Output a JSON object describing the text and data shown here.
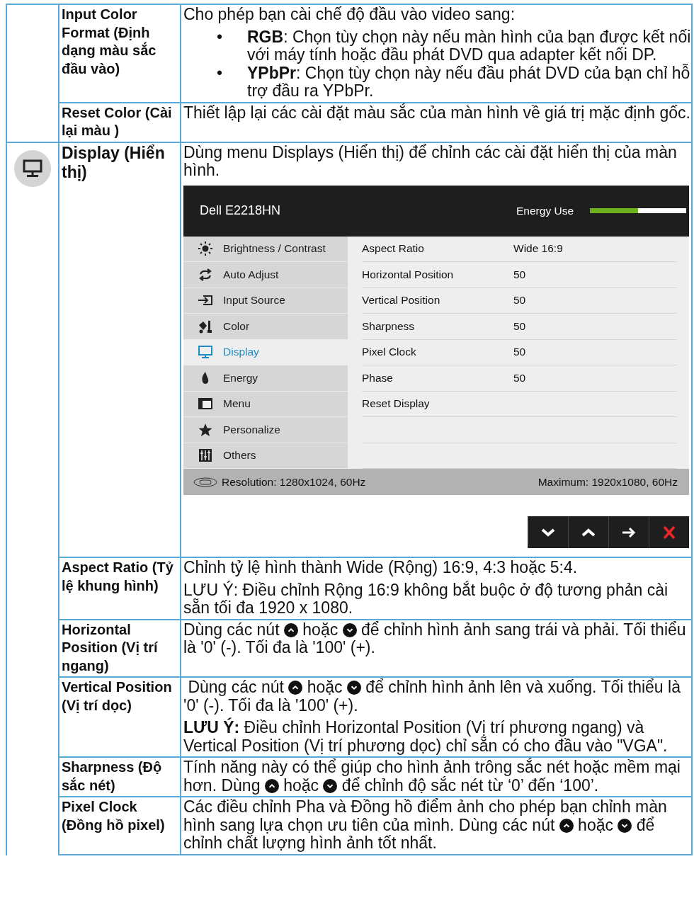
{
  "groups": [
    {
      "kind": "continued",
      "rows": [
        {
          "name": "Input Color Format (Định dạng màu sắc đầu vào)",
          "blocks": [
            {
              "kind": "paragraph",
              "parts": [
                {
                  "kind": "text",
                  "text": "Cho phép bạn cài chế độ đầu vào video sang:"
                }
              ]
            },
            {
              "kind": "bullets",
              "items": [
                {
                  "mark": "•",
                  "text": "**RGB**: Chọn tùy chọn này nếu màn hình của bạn được kết nối với máy tính hoặc đầu phát DVD qua adapter kết nối DP."
                },
                {
                  "mark": "•",
                  "text": "**YPbPr**: Chọn tùy chọn này nếu đầu phát DVD của bạn chỉ hỗ trợ đầu ra YPbPr."
                }
              ]
            }
          ]
        },
        {
          "name": "Reset Color (Cài lại màu )",
          "blocks": [
            {
              "kind": "paragraph",
              "parts": [
                {
                  "kind": "text",
                  "text": "Thiết lập lại các cài đặt màu sắc của màn hình về giá trị mặc định gốc."
                }
              ]
            }
          ]
        }
      ]
    },
    {
      "kind": "display",
      "rows": [
        {
          "name": "Display (Hiển thị)",
          "large": true,
          "blocks": [
            {
              "kind": "paragraph",
              "parts": [
                {
                  "kind": "text",
                  "text": "Dùng menu Displays (Hiển thị) để chỉnh các cài đặt hiển thị của màn hình."
                }
              ]
            },
            {
              "kind": "osd",
              "osd": {
                "title": "Dell E2218HN",
                "energy": {
                  "label": "Energy Use",
                  "level": 0.5
                },
                "menu": [
                  {
                    "kind": "brightness",
                    "label": "Brightness / Contrast",
                    "selected": false
                  },
                  {
                    "kind": "auto",
                    "label": "Auto Adjust",
                    "selected": false
                  },
                  {
                    "kind": "input",
                    "label": "Input Source",
                    "selected": false
                  },
                  {
                    "kind": "color",
                    "label": "Color",
                    "selected": false
                  },
                  {
                    "kind": "display",
                    "label": "Display",
                    "selected": true
                  },
                  {
                    "kind": "energy",
                    "label": "Energy",
                    "selected": false
                  },
                  {
                    "kind": "menu",
                    "label": "Menu",
                    "selected": false
                  },
                  {
                    "kind": "personalize",
                    "label": "Personalize",
                    "selected": false
                  },
                  {
                    "kind": "others",
                    "label": "Others",
                    "selected": false
                  }
                ],
                "settings": [
                  {
                    "label": "Aspect Ratio",
                    "value": "Wide 16:9"
                  },
                  {
                    "label": "Horizontal Position",
                    "value": "50"
                  },
                  {
                    "label": "Vertical Position",
                    "value": "50"
                  },
                  {
                    "label": "Sharpness",
                    "value": "50"
                  },
                  {
                    "label": "Pixel Clock",
                    "value": "50"
                  },
                  {
                    "label": "Phase",
                    "value": "50"
                  },
                  {
                    "label": "Reset Display"
                  }
                ],
                "resolution": "Resolution: 1280x1024, 60Hz",
                "maximum": "Maximum: 1920x1080, 60Hz",
                "buttons": [
                  {
                    "kind": "down"
                  },
                  {
                    "kind": "up"
                  },
                  {
                    "kind": "right"
                  },
                  {
                    "kind": "close"
                  }
                ]
              }
            }
          ]
        },
        {
          "name": "Aspect Ratio (Tỷ lệ khung hình)",
          "blocks": [
            {
              "kind": "paragraph",
              "parts": [
                {
                  "kind": "text",
                  "text": "Chỉnh tỷ lệ hình thành Wide (Rộng) 16:9, 4:3 hoặc 5:4."
                }
              ]
            },
            {
              "kind": "paragraph",
              "parts": [
                {
                  "kind": "text",
                  "text": "LƯU Ý: Điều chỉnh Rộng 16:9 không bắt buộc ở độ tương phản cài sẵn tối đa 1920 x 1080."
                }
              ]
            }
          ]
        },
        {
          "name": "Horizontal Position (Vị trí ngang)",
          "blocks": [
            {
              "kind": "paragraph",
              "parts": [
                {
                  "kind": "text",
                  "text": "Dùng các nút "
                },
                {
                  "kind": "up"
                },
                {
                  "kind": "text",
                  "text": " hoặc "
                },
                {
                  "kind": "down"
                },
                {
                  "kind": "text",
                  "text": " để chỉnh hình ảnh sang trái và phải. Tối thiểu là '0' (-). Tối đa là '100' (+)."
                }
              ]
            }
          ]
        },
        {
          "name": "Vertical Position (Vị trí dọc)",
          "blocks": [
            {
              "kind": "paragraph",
              "parts": [
                {
                  "kind": "text",
                  "text": " Dùng các nút "
                },
                {
                  "kind": "up"
                },
                {
                  "kind": "text",
                  "text": " hoặc "
                },
                {
                  "kind": "down"
                },
                {
                  "kind": "text",
                  "text": " để chỉnh hình ảnh lên và xuống. Tối thiểu là '0' (-). Tối đa là '100' (+)."
                }
              ]
            },
            {
              "kind": "paragraph",
              "parts": [
                {
                  "kind": "text",
                  "text": "**LƯU Ý:** Điều chỉnh Horizontal Position (Vị trí phương ngang) và Vertical Position (Vị trí phương dọc) chỉ sẵn có cho đầu vào \"VGA\"."
                }
              ]
            }
          ]
        },
        {
          "name": "Sharpness (Độ sắc nét)",
          "blocks": [
            {
              "kind": "paragraph",
              "parts": [
                {
                  "kind": "text",
                  "text": "Tính năng này có thể giúp cho hình ảnh trông sắc nét hoặc mềm mại hơn. Dùng "
                },
                {
                  "kind": "up"
                },
                {
                  "kind": "text",
                  "text": " hoặc "
                },
                {
                  "kind": "down"
                },
                {
                  "kind": "text",
                  "text": " để chỉnh độ sắc nét từ ‘0’ đến ‘100’."
                }
              ]
            }
          ]
        },
        {
          "name": "Pixel Clock (Đồng hồ pixel)",
          "blocks": [
            {
              "kind": "paragraph",
              "parts": [
                {
                  "kind": "text",
                  "text": "Các điều chỉnh Pha và Đồng hồ điểm ảnh cho phép bạn chỉnh màn hình sang lựa chọn ưu tiên của mình. Dùng các nút "
                },
                {
                  "kind": "up"
                },
                {
                  "kind": "text",
                  "text": " hoặc "
                },
                {
                  "kind": "down"
                },
                {
                  "kind": "text",
                  "text": " để chỉnh chất lượng hình ảnh tốt nhất."
                }
              ]
            }
          ]
        }
      ]
    }
  ]
}
